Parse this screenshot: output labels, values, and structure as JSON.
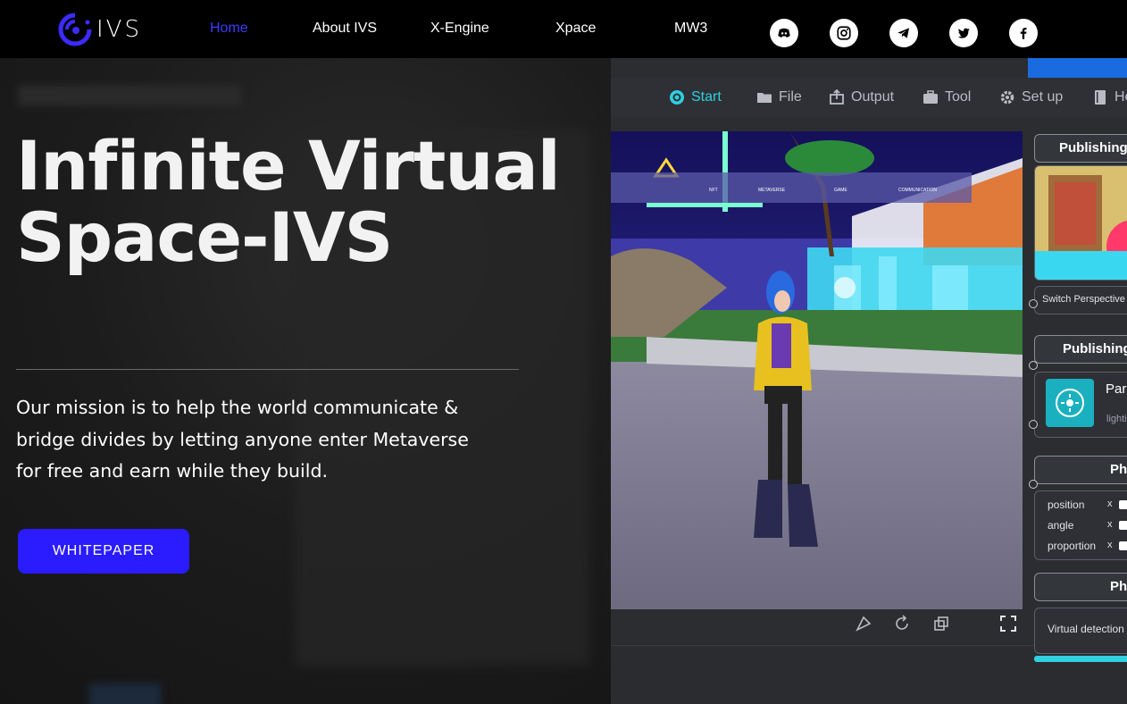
{
  "nav": {
    "logo_text": "IVS",
    "links": [
      {
        "label": "Home",
        "active": true
      },
      {
        "label": "About IVS"
      },
      {
        "label": "X-Engine"
      },
      {
        "label": "Xpace"
      },
      {
        "label": "MW3"
      }
    ],
    "social": [
      "discord-icon",
      "instagram-icon",
      "telegram-icon",
      "twitter-icon",
      "facebook-icon"
    ]
  },
  "hero": {
    "headline_line1": "Infinite Virtual",
    "headline_line2": "Space-IVS",
    "mission": "Our mission is to help the world communicate & bridge divides by letting anyone enter Metaverse for free and earn while they build.",
    "cta_label": "WHITEPAPER"
  },
  "editor": {
    "menu": [
      {
        "label": "Start",
        "icon": "start-icon",
        "active": true
      },
      {
        "label": "File",
        "icon": "folder-icon"
      },
      {
        "label": "Output",
        "icon": "output-icon"
      },
      {
        "label": "Tool",
        "icon": "toolbox-icon"
      },
      {
        "label": "Set up",
        "icon": "gear-icon"
      },
      {
        "label": "He",
        "icon": "book-icon"
      }
    ],
    "scene_banner": [
      "NFT",
      "METAVERSE",
      "GAME",
      "COMMUNICATION"
    ],
    "panels": {
      "publishing_1": "Publishing",
      "switch_perspective": "Switch Perspective",
      "publishing_2": "Publishing",
      "par_title": "Par",
      "par_sub": "lighti",
      "ph_1": "Ph",
      "props": [
        "position",
        "angle",
        "proportion"
      ],
      "axis_label": "x",
      "ph_2": "Ph",
      "virtual_detection": "Virtual detection"
    },
    "colors": {
      "accent": "#2fd0e0",
      "cta": "#2a1cff",
      "nav_active": "#3c3cff"
    }
  }
}
